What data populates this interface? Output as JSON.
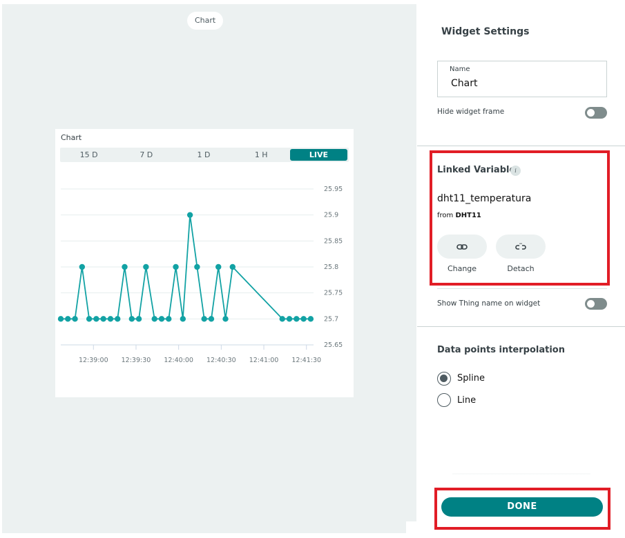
{
  "canvas": {
    "title_pill": "Chart"
  },
  "widget": {
    "title": "Chart",
    "ranges": [
      {
        "label": "15 D",
        "active": false
      },
      {
        "label": "7 D",
        "active": false
      },
      {
        "label": "1 D",
        "active": false
      },
      {
        "label": "1 H",
        "active": false
      },
      {
        "label": "LIVE",
        "active": true
      }
    ]
  },
  "chart_data": {
    "type": "line",
    "title": "Chart",
    "xlabel": "",
    "ylabel": "",
    "x_unit": "seconds after 12:39:00",
    "x_ticks": [
      {
        "t": 0,
        "label": "12:39:00"
      },
      {
        "t": 30,
        "label": "12:39:30"
      },
      {
        "t": 60,
        "label": "12:40:00"
      },
      {
        "t": 90,
        "label": "12:40:30"
      },
      {
        "t": 120,
        "label": "12:41:00"
      },
      {
        "t": 150,
        "label": "12:41:30"
      }
    ],
    "xlim": [
      -23,
      155
    ],
    "y_ticks": [
      25.65,
      25.7,
      25.75,
      25.8,
      25.85,
      25.9,
      25.95
    ],
    "ylim": [
      25.65,
      25.95
    ],
    "y_axis_side": "right",
    "grid": true,
    "color": "#12a2a4",
    "series": [
      {
        "name": "dht11_temperatura",
        "x": [
          -23,
          -18,
          -13,
          -8,
          -3,
          2,
          7,
          12,
          17,
          22,
          27,
          32,
          37,
          43,
          48,
          53,
          58,
          63,
          68,
          73,
          78,
          83,
          88,
          93,
          98,
          133,
          138,
          143,
          148,
          153
        ],
        "y": [
          25.7,
          25.7,
          25.7,
          25.8,
          25.7,
          25.7,
          25.7,
          25.7,
          25.7,
          25.8,
          25.7,
          25.7,
          25.8,
          25.7,
          25.7,
          25.7,
          25.8,
          25.7,
          25.9,
          25.8,
          25.7,
          25.7,
          25.8,
          25.7,
          25.8,
          25.7,
          25.7,
          25.7,
          25.7,
          25.7
        ]
      }
    ]
  },
  "panel": {
    "title": "Widget Settings",
    "name_label": "Name",
    "name_value": "Chart",
    "hide_frame_label": "Hide widget frame",
    "hide_frame_on": false,
    "linked_variable": {
      "title": "Linked Variable",
      "info_icon": "i",
      "variable_name": "dht11_temperatura",
      "from_prefix": "from",
      "thing_name": "DHT11",
      "change_label": "Change",
      "detach_label": "Detach"
    },
    "show_thing_label": "Show Thing name on widget",
    "show_thing_on": false,
    "interpolation": {
      "title": "Data points interpolation",
      "options": [
        {
          "label": "Spline",
          "checked": true
        },
        {
          "label": "Line",
          "checked": false
        }
      ]
    },
    "done_label": "DONE"
  },
  "colors": {
    "accent": "#008184",
    "series": "#12a2a4",
    "highlight": "#e11d26",
    "canvas_bg": "#ecf1f1"
  }
}
